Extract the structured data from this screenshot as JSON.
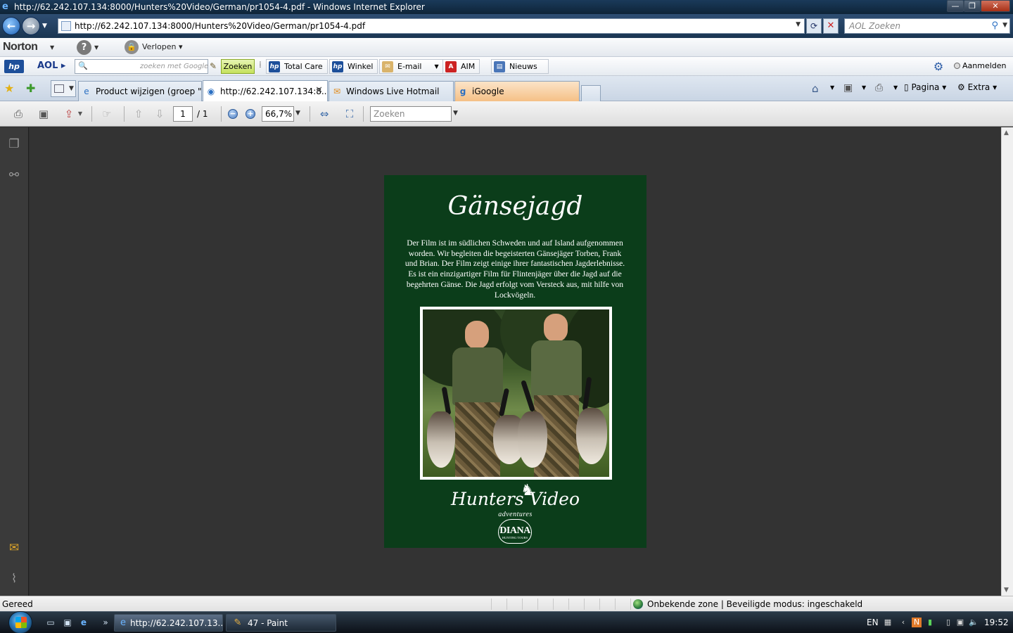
{
  "window": {
    "title": "http://62.242.107.134:8000/Hunters%20Video/German/pr1054-4.pdf - Windows Internet Explorer",
    "minimize": "—",
    "maximize": "❐",
    "close": "✕"
  },
  "address": {
    "url": "http://62.242.107.134:8000/Hunters%20Video/German/pr1054-4.pdf",
    "search_placeholder": "AOL Zoeken"
  },
  "norton": {
    "logo": "Norton",
    "verlopen": "Verlopen"
  },
  "aol_toolbar": {
    "hp_label": "hp",
    "aol_label": "AOL",
    "search_hint": "zoeken met Google",
    "zoeken": "Zoeken",
    "buttons": [
      "Total Care",
      "Winkel",
      "E-mail",
      "AIM",
      "Nieuws"
    ],
    "aanmelden": "Aanmelden"
  },
  "tabs": [
    {
      "label": "Product wijzigen (groep \"..."
    },
    {
      "label": "http://62.242.107.134:8...",
      "active": true
    },
    {
      "label": "Windows Live Hotmail"
    },
    {
      "label": "iGoogle"
    }
  ],
  "command_bar": {
    "pagina": "Pagina",
    "extra": "Extra"
  },
  "pdf_toolbar": {
    "page_current": "1",
    "page_total": "/ 1",
    "zoom": "66,7%",
    "search_placeholder": "Zoeken"
  },
  "document": {
    "title": "Gänsejagd",
    "body": "Der Film ist im südlichen Schweden und auf Island aufgenommen worden. Wir begleiten die begeisterten Gänsejäger Torben, Frank und Brian. Der Film zeigt einige ihrer fantastischen Jagderlebnisse. Es ist ein einzigartiger Film für Flintenjäger über die Jagd auf die begehrten Gänse. Die Jagd erfolgt vom Versteck aus, mit hilfe von Lockvögeln.",
    "logo_main": "Hunters   Video",
    "logo_sub": "adventures",
    "diana": "DIANA",
    "diana_sub": "HUNTING TOURS"
  },
  "status": {
    "text": "Gereed",
    "zone": "Onbekende zone | Beveiligde modus: ingeschakeld"
  },
  "taskbar": {
    "tasks": [
      "http://62.242.107.13...",
      "47 - Paint"
    ],
    "language": "EN",
    "clock": "19:52"
  },
  "colors": {
    "pdf_background": "#0b3d1a",
    "viewer_background": "#333333"
  }
}
